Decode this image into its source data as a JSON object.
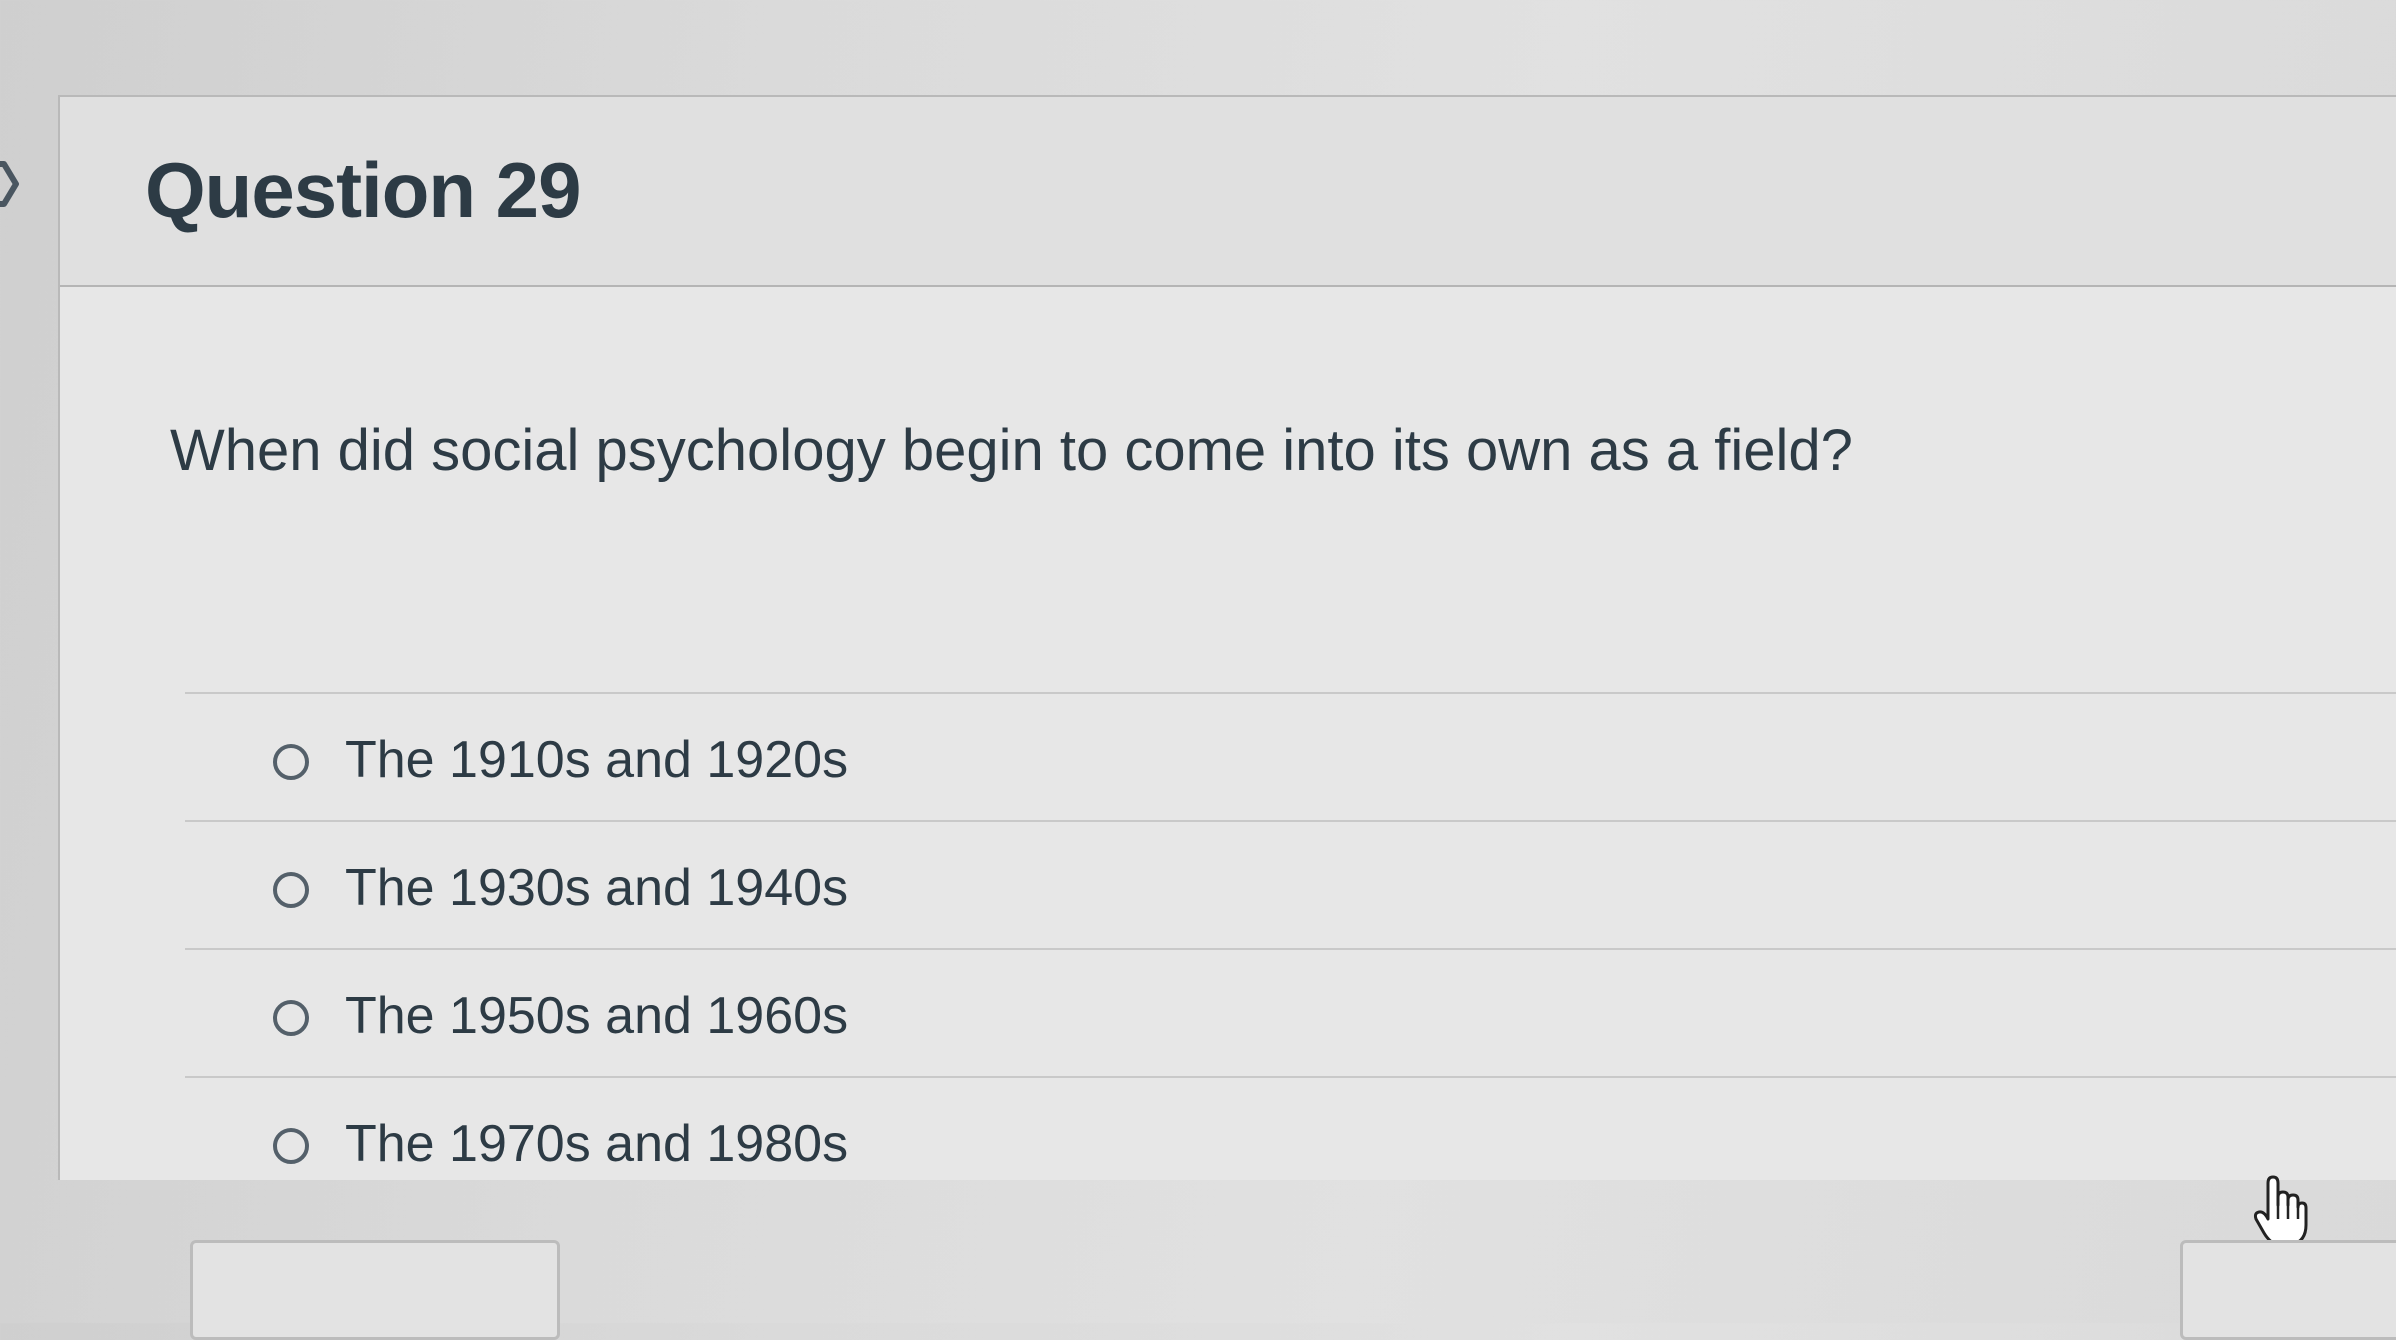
{
  "question": {
    "title": "Question 29",
    "text": "When did social psychology begin to come into its own as a field?",
    "answers": [
      {
        "label": "The 1910s and 1920s",
        "selected": false
      },
      {
        "label": "The 1930s and 1940s",
        "selected": false
      },
      {
        "label": "The 1950s and 1960s",
        "selected": false
      },
      {
        "label": "The 1970s and 1980s",
        "selected": false
      }
    ]
  },
  "icons": {
    "flag": "flag-question-icon",
    "cursor": "hand-pointer-icon"
  },
  "colors": {
    "text": "#2d3b45",
    "radio_border": "#54606a"
  }
}
